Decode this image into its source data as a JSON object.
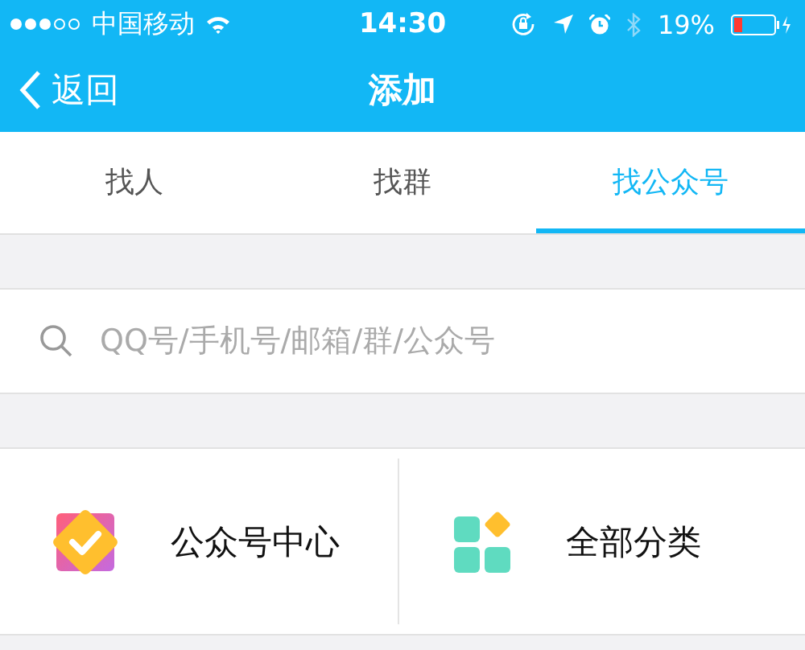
{
  "status_bar": {
    "carrier": "中国移动",
    "time": "14:30",
    "battery_text": "19%"
  },
  "nav": {
    "back": "返回",
    "title": "添加"
  },
  "tabs": [
    {
      "label": "找人",
      "selected": false
    },
    {
      "label": "找群",
      "selected": false
    },
    {
      "label": "找公众号",
      "selected": true
    }
  ],
  "search": {
    "placeholder": "QQ号/手机号/邮箱/群/公众号"
  },
  "entries": [
    {
      "kind": "center",
      "label": "公众号中心"
    },
    {
      "kind": "categories",
      "label": "全部分类"
    }
  ]
}
